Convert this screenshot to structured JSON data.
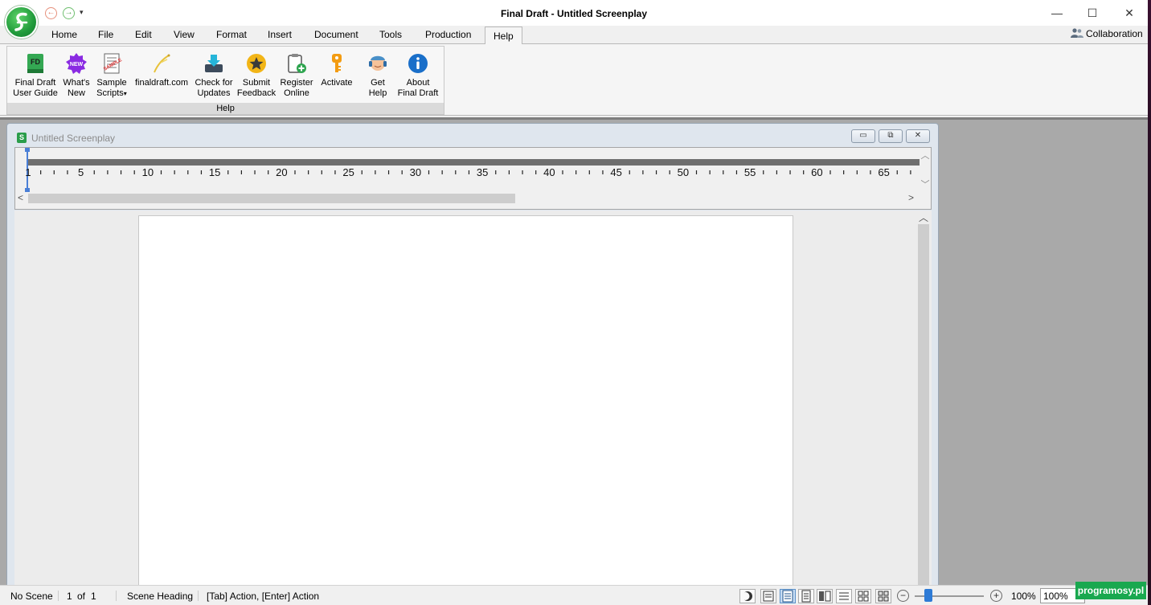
{
  "window": {
    "title": "Final Draft - Untitled Screenplay",
    "min": "—",
    "max": "☐",
    "close": "✕"
  },
  "quick_access": {
    "back": "←",
    "forward": "→",
    "dropdown": "▾"
  },
  "menu_tabs": [
    {
      "label": "Home"
    },
    {
      "label": "File"
    },
    {
      "label": "Edit"
    },
    {
      "label": "View"
    },
    {
      "label": "Format"
    },
    {
      "label": "Insert"
    },
    {
      "label": "Document"
    },
    {
      "label": "Tools"
    },
    {
      "label": "Production"
    },
    {
      "label": "Help",
      "active": true
    }
  ],
  "collaboration": "Collaboration",
  "ribbon": {
    "group_label": "Help",
    "buttons": [
      {
        "line1": "Final Draft",
        "line2": "User Guide",
        "icon": "fd-book-icon"
      },
      {
        "line1": "What's",
        "line2": "New",
        "icon": "new-badge-icon"
      },
      {
        "line1": "Sample",
        "line2": "Scripts",
        "icon": "sample-scripts-icon",
        "dropdown": "▾"
      },
      {
        "line1": "finaldraft.com",
        "line2": "",
        "icon": "pen-nib-icon"
      },
      {
        "line1": "Check for",
        "line2": "Updates",
        "icon": "download-updates-icon"
      },
      {
        "line1": "Submit",
        "line2": "Feedback",
        "icon": "star-icon"
      },
      {
        "line1": "Register",
        "line2": "Online",
        "icon": "clipboard-add-icon"
      },
      {
        "line1": "Activate",
        "line2": "",
        "icon": "key-icon"
      },
      {
        "line1": "Get",
        "line2": "Help",
        "icon": "support-agent-icon"
      },
      {
        "line1": "About",
        "line2": "Final Draft",
        "icon": "info-icon"
      }
    ]
  },
  "document": {
    "title": "Untitled Screenplay",
    "icon_letter": "S",
    "controls": {
      "min": "▭",
      "restore": "⧉",
      "close": "✕"
    }
  },
  "ruler": {
    "labels": [
      "1",
      "5",
      "10",
      "15",
      "20",
      "25",
      "30",
      "35",
      "40",
      "45",
      "50",
      "55",
      "60",
      "65"
    ]
  },
  "statusbar": {
    "scene": "No Scene",
    "page": "1",
    "of": "of",
    "pages": "1",
    "element": "Scene Heading",
    "hint": "[Tab]  Action,  [Enter] Action",
    "zoom_label": "100%",
    "zoom_value": "100%",
    "zoom_fraction": 0.2
  },
  "watermark": "programosy.pl",
  "colors": {
    "accent": "#2e7bd6",
    "brand_green": "#1f9a3a",
    "workspace": "#a9a9a9"
  }
}
